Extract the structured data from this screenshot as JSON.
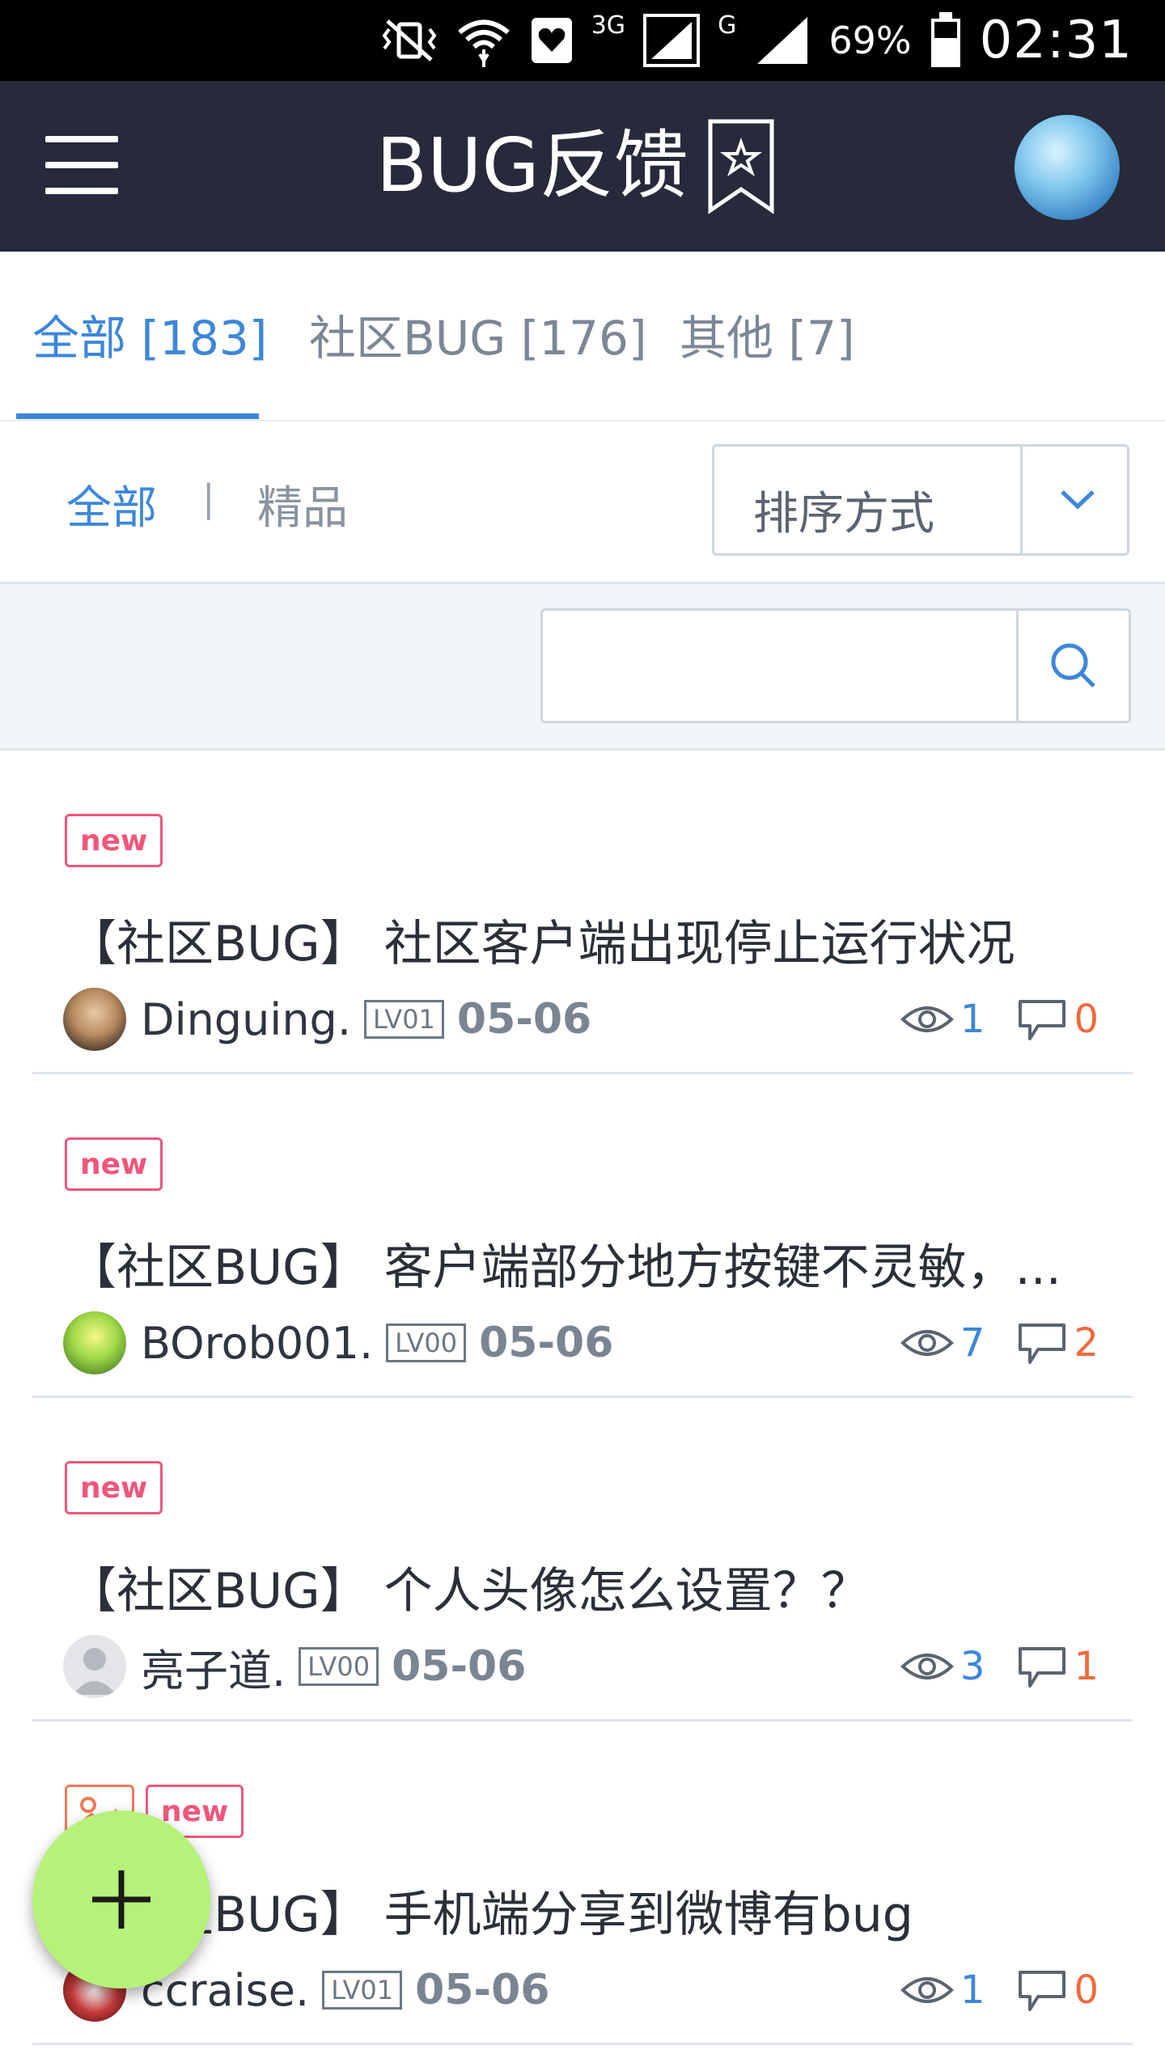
{
  "status_bar": {
    "battery_pct": "69%",
    "time": "02:31",
    "network_3g": "3G",
    "network_g": "G"
  },
  "app_bar": {
    "title": "BUG反馈"
  },
  "tabs": [
    {
      "label": "全部 [183]",
      "active": true
    },
    {
      "label": "社区BUG [176]",
      "active": false
    },
    {
      "label": "其他 [7]",
      "active": false
    }
  ],
  "filters": {
    "all_label": "全部",
    "separator": "|",
    "best_label": "精品",
    "sort_label": "排序方式"
  },
  "search": {
    "placeholder": ""
  },
  "posts": [
    {
      "badges": [
        "new"
      ],
      "has_image_badge": false,
      "title": "【社区BUG】 社区客户端出现停止运行状况",
      "author": "Dinguing.",
      "level": "LV01",
      "date": "05-06",
      "views": "1",
      "comments": "0"
    },
    {
      "badges": [
        "new"
      ],
      "has_image_badge": false,
      "title": "【社区BUG】 客户端部分地方按键不灵敏，...",
      "author": "BOrob001.",
      "level": "LV00",
      "date": "05-06",
      "views": "7",
      "comments": "2"
    },
    {
      "badges": [
        "new"
      ],
      "has_image_badge": false,
      "title": "【社区BUG】 个人头像怎么设置？？",
      "author": "亮子道.",
      "level": "LV00",
      "date": "05-06",
      "views": "3",
      "comments": "1"
    },
    {
      "badges": [
        "new"
      ],
      "has_image_badge": true,
      "title": "【社区BUG】 手机端分享到微博有bug",
      "author": "ccraise.",
      "level": "LV01",
      "date": "05-06",
      "views": "1",
      "comments": "0"
    }
  ],
  "colors": {
    "app_bar_bg": "#262a3a",
    "accent_blue": "#3d87d8",
    "badge_pink": "#f0567c",
    "comment_orange": "#f06a3c",
    "fab_green": "#b6f27a"
  }
}
